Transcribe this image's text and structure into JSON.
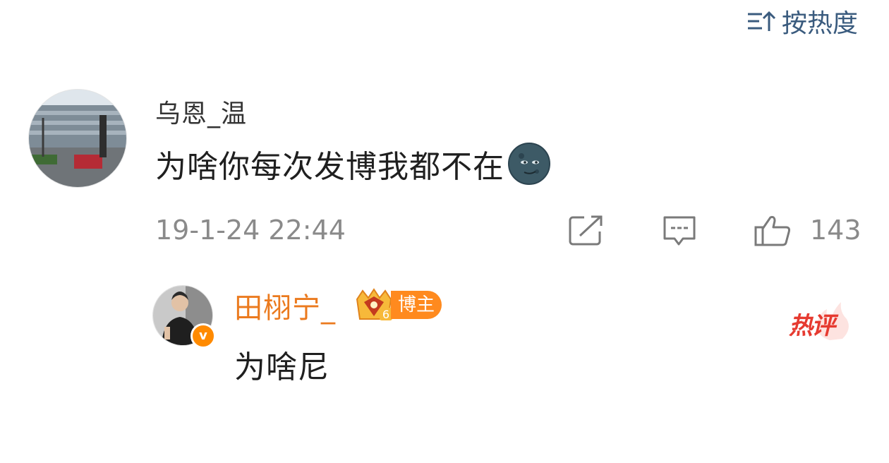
{
  "sort": {
    "label": "按热度",
    "icon": "sort-up-icon"
  },
  "comment": {
    "avatar": "building-street-avatar",
    "username": "乌恩_温",
    "text": "为啥你每次发博我都不在",
    "emoji": "moon-face-emoji",
    "timestamp": "19-1-24 22:44",
    "actions": {
      "share_icon": "share-icon",
      "reply_icon": "comment-bubble-icon",
      "like_icon": "thumbs-up-icon",
      "like_count": "143"
    }
  },
  "reply": {
    "avatar": "person-avatar",
    "verified_badge": "v",
    "username": "田栩宁_",
    "crown_level": "6",
    "role_tag": "博主",
    "text": "为啥尼",
    "hot_tag": "热评"
  },
  "colors": {
    "sort_blue": "#3a5b7e",
    "username_orange": "#eb7a1e",
    "tag_orange": "#ff8a1e",
    "hot_red": "#e63a30",
    "meta_gray": "#8a8a8a"
  }
}
